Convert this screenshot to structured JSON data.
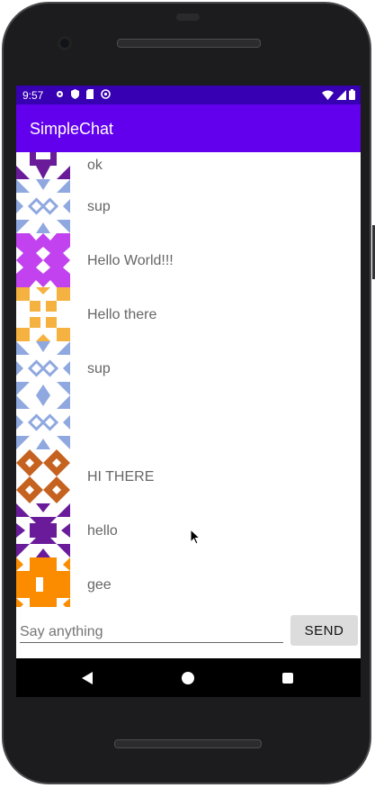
{
  "status_bar": {
    "time": "9:57"
  },
  "app_bar": {
    "title": "SimpleChat"
  },
  "messages": [
    {
      "text": "ok",
      "avatar_color": "#6a1b9a"
    },
    {
      "text": "sup",
      "avatar_color": "#8fa8e0"
    },
    {
      "text": "Hello World!!!",
      "avatar_color": "#c142ee"
    },
    {
      "text": "Hello there",
      "avatar_color": "#f5b240"
    },
    {
      "text": "sup",
      "avatar_color": "#8fa8e0"
    },
    {
      "text": "",
      "avatar_color": "#8fa8e0"
    },
    {
      "text": "HI THERE",
      "avatar_color": "#c5621f"
    },
    {
      "text": "hello",
      "avatar_color": "#6a1b9a"
    },
    {
      "text": "gee",
      "avatar_color": "#fb8c00"
    }
  ],
  "composer": {
    "placeholder": "Say anything",
    "send_label": "SEND"
  },
  "colors": {
    "status_bar": "#3700b3",
    "app_bar": "#6200ee"
  }
}
